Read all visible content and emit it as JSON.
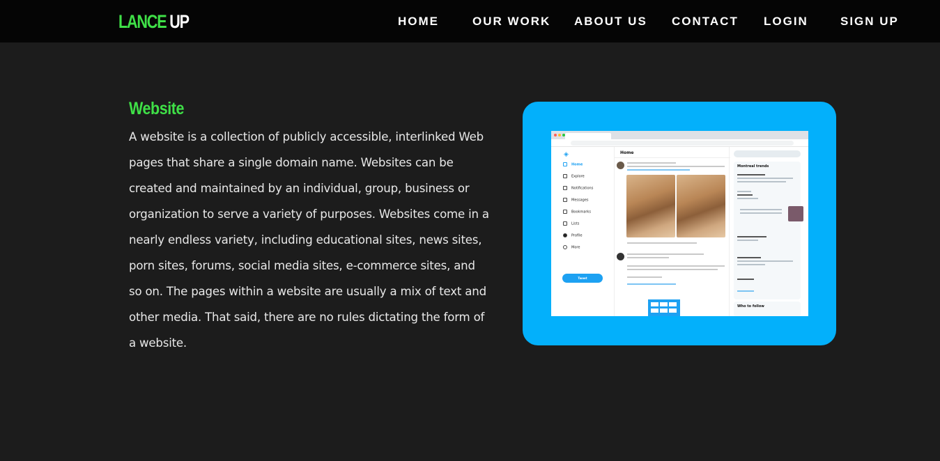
{
  "brand": {
    "part1": "LANCE",
    "part2": "UP",
    "accent_color": "#3fe047"
  },
  "nav": {
    "home": "HOME",
    "our_work": "OUR WORK",
    "about_us": "ABOUT US",
    "contact": "CONTACT",
    "login": "LOGIN",
    "signup": "SIGN UP"
  },
  "section": {
    "title": "Website",
    "body": "A website is a collection of publicly accessible, interlinked Web pages that share a single domain name. Websites can be created and maintained by an individual, group, business or organization to serve a variety of purposes. Websites come in a nearly endless variety, including educational sites, news sites, porn sites, forums, social media sites, e-commerce sites, and so on. The pages within a website are usually a mix of text and other media. That said, there are no rules dictating the form of a website."
  },
  "image_card": {
    "background_color": "#03b0fb",
    "screenshot": {
      "feed_title": "Home",
      "nav_items": [
        "Home",
        "Explore",
        "Notifications",
        "Messages",
        "Bookmarks",
        "Lists",
        "Profile",
        "More"
      ],
      "tweet_button": "Tweet",
      "trends_title": "Montreal trends",
      "follow_title": "Who to follow"
    }
  },
  "colors": {
    "page_bg": "#1c1c1c",
    "navbar_bg": "#050505",
    "body_text": "#e8e8e8"
  }
}
